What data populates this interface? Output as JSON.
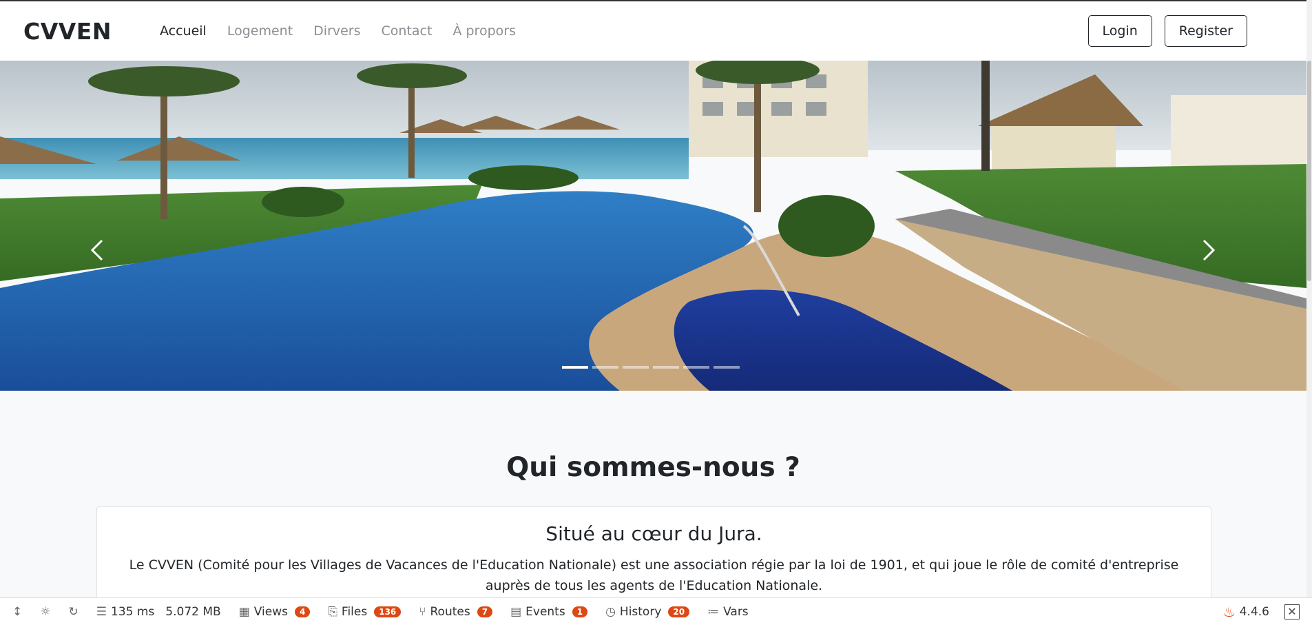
{
  "navbar": {
    "brand": "CVVEN",
    "links": [
      {
        "label": "Accueil",
        "active": true
      },
      {
        "label": "Logement",
        "active": false
      },
      {
        "label": "Dirvers",
        "active": false
      },
      {
        "label": "Contact",
        "active": false
      },
      {
        "label": "À propors",
        "active": false
      }
    ],
    "login_label": "Login",
    "register_label": "Register"
  },
  "carousel": {
    "slide_count": 6,
    "active_index": 0,
    "image_description_icon": "resort-pool-photo"
  },
  "section": {
    "title": "Qui sommes-nous ?"
  },
  "card": {
    "title": "Situé au cœur du Jura.",
    "text": "Le CVVEN (Comité pour les Villages de Vacances de l'Education Nationale) est une association régie par la loi de 1901, et qui joue le rôle de comité d'entreprise auprès de tous les agents de l'Education Nationale."
  },
  "debugbar": {
    "time": "135 ms",
    "memory": "5.072 MB",
    "views_label": "Views",
    "views_count": "4",
    "files_label": "Files",
    "files_count": "136",
    "routes_label": "Routes",
    "routes_count": "7",
    "events_label": "Events",
    "events_count": "1",
    "history_label": "History",
    "history_count": "20",
    "vars_label": "Vars",
    "version": "4.4.6"
  },
  "colors": {
    "badge": "#dd4814",
    "brand_text": "#212529",
    "nav_inactive": "#8a8f94"
  }
}
